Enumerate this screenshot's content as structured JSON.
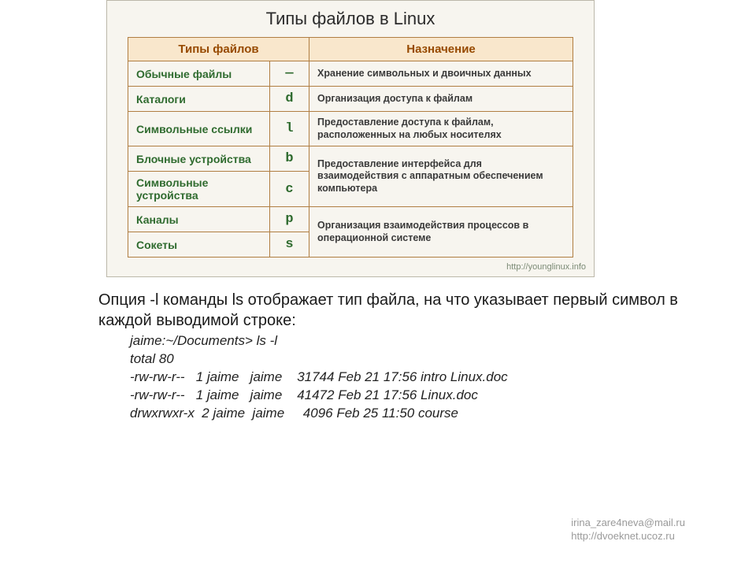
{
  "table": {
    "title": "Типы файлов в Linux",
    "headers": {
      "type": "Типы файлов",
      "purpose": "Назначение"
    },
    "rows": [
      {
        "name": "Обычные файлы",
        "sym": "—",
        "desc": "Хранение символьных и двоичных данных"
      },
      {
        "name": "Каталоги",
        "sym": "d",
        "desc": "Организация доступа к файлам"
      },
      {
        "name": "Символьные ссылки",
        "sym": "l",
        "desc": "Предоставление доступа к файлам, расположенных на любых носителях"
      },
      {
        "name": "Блочные устройства",
        "sym": "b",
        "desc": "Предоставление интерфейса для взаимодействия с аппаратным обеспечением компьютера"
      },
      {
        "name": "Символьные устройства",
        "sym": "с",
        "desc": ""
      },
      {
        "name": "Каналы",
        "sym": "p",
        "desc": "Организация взаимодействия процессов в операционной системе"
      },
      {
        "name": "Сокеты",
        "sym": "s",
        "desc": ""
      }
    ],
    "source": "http://younglinux.info"
  },
  "paragraph": "Опция -l команды ls отображает тип файла, на что указывает первый символ в каждой выводимой строке:",
  "terminal": [
    "jaime:~/Documents> ls -l",
    "total 80",
    "-rw-rw-r--   1 jaime   jaime    31744 Feb 21 17:56 intro Linux.doc",
    "-rw-rw-r--   1 jaime   jaime    41472 Feb 21 17:56 Linux.doc",
    "drwxrwxr-x  2 jaime  jaime     4096 Feb 25 11:50 course"
  ],
  "footer": {
    "email": "irina_zare4neva@mail.ru",
    "url": "http://dvoeknet.ucoz.ru"
  }
}
